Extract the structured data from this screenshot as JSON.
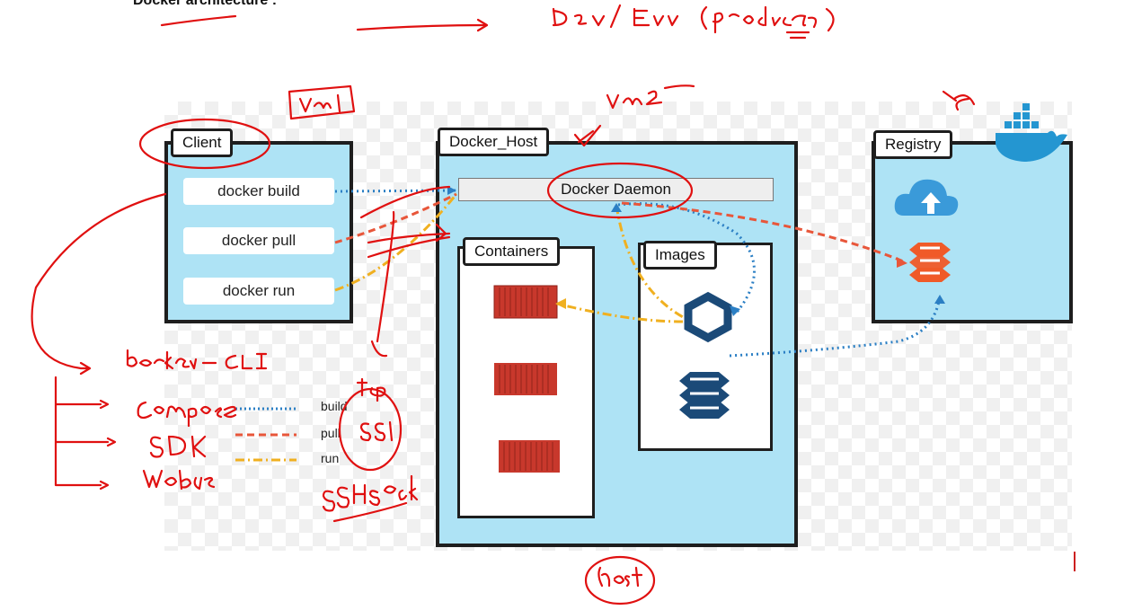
{
  "page_title": "Docker architecture :",
  "panels": {
    "client": {
      "label": "Client"
    },
    "docker_host": {
      "label": "Docker_Host"
    },
    "registry": {
      "label": "Registry"
    }
  },
  "commands": [
    "docker build",
    "docker pull",
    "docker run"
  ],
  "daemon_label": "Docker Daemon",
  "containers_label": "Containers",
  "images_label": "Images",
  "legend": [
    {
      "label": "build",
      "color": "#2b7fc4",
      "style": "dotted"
    },
    {
      "label": "pull",
      "color": "#e8563a",
      "style": "dashed"
    },
    {
      "label": "run",
      "color": "#f0b020",
      "style": "dash-dot"
    }
  ],
  "colors": {
    "panel_fill": "#aee3f5",
    "container_red": "#c8382c",
    "image_navy": "#1b4a78",
    "registry_orange": "#f05a28",
    "cloud_blue": "#3a9ad9",
    "annotation_red": "#e01010"
  },
  "icons": [
    "docker-whale-icon",
    "cloud-upload-icon",
    "registry-stack-icon",
    "image-hexagon-icon",
    "image-stack-icon",
    "shipping-container-icon"
  ],
  "handwritten_annotations": {
    "top": "Dev / Env (production)",
    "client_note": "vm1",
    "host_note": "vm2",
    "registry_note": "vm",
    "list": [
      "docker-CLI",
      "compose",
      "SDK",
      "webui"
    ],
    "protocols": [
      "tcp",
      "ssl"
    ],
    "ssh_note": "SSH sock",
    "host_bottom": "host"
  }
}
